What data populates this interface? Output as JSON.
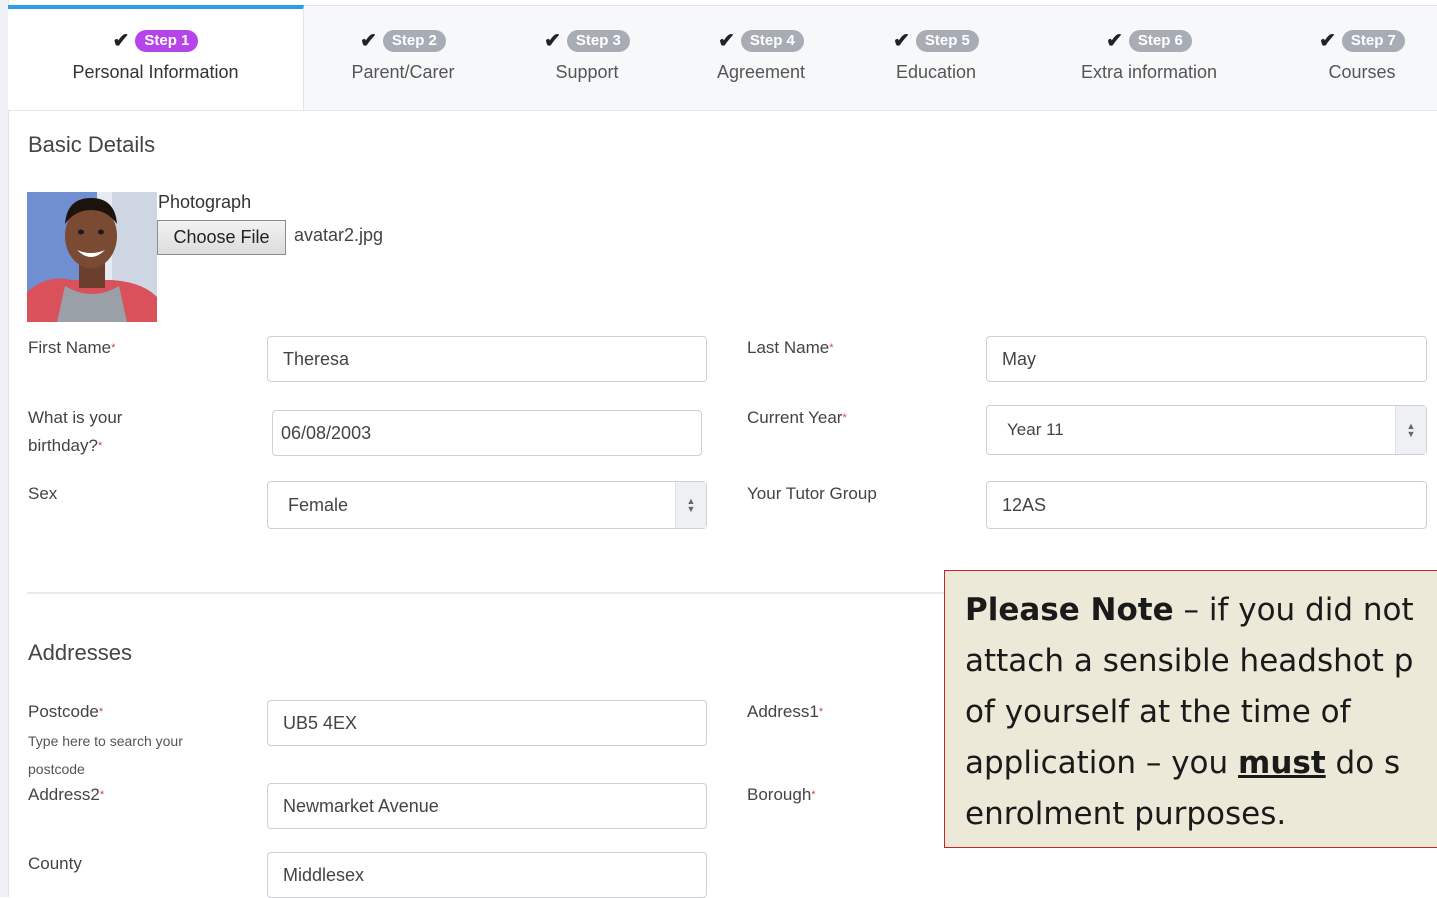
{
  "tabs": [
    {
      "step": "Step 1",
      "label": "Personal Information",
      "active": true
    },
    {
      "step": "Step 2",
      "label": "Parent/Carer"
    },
    {
      "step": "Step 3",
      "label": "Support"
    },
    {
      "step": "Step 4",
      "label": "Agreement"
    },
    {
      "step": "Step 5",
      "label": "Education"
    },
    {
      "step": "Step 6",
      "label": "Extra information"
    },
    {
      "step": "Step 7",
      "label": "Courses"
    }
  ],
  "check_glyph": "✔",
  "basic": {
    "title": "Basic Details",
    "photo_label": "Photograph",
    "choose_file": "Choose File",
    "file_name": "avatar2.jpg",
    "first_name_label": "First Name",
    "first_name": "Theresa",
    "last_name_label": "Last Name",
    "last_name": "May",
    "birthday_label_1": "What is your",
    "birthday_label_2": "birthday?",
    "birthday": "06/08/2003",
    "current_year_label": "Current Year",
    "current_year": "Year 11",
    "sex_label": "Sex",
    "sex": "Female",
    "tutor_label": "Your Tutor Group",
    "tutor": "12AS",
    "required_mark": "*"
  },
  "addresses": {
    "title": "Addresses",
    "postcode_label": "Postcode",
    "postcode_hint_1": "Type here to search your",
    "postcode_hint_2": "postcode",
    "postcode": "UB5 4EX",
    "address1_label": "Address1",
    "address2_label": "Address2",
    "address2": "Newmarket Avenue",
    "borough_label": "Borough",
    "county_label": "County",
    "county": "Middlesex"
  },
  "note": {
    "bold_lead": "Please Note",
    "line1_rest": " – if you did not",
    "line2": "attach a sensible headshot p",
    "line3": "of yourself at the time of",
    "line4_a": "application – you ",
    "line4_must": "must",
    "line4_b": " do s",
    "line5": "enrolment purposes."
  },
  "colors": {
    "active_tab_accent": "#2f9ee8",
    "active_step_badge": "#b545e8",
    "inactive_step_badge": "#a8adb5",
    "required": "#e0413b",
    "note_border": "#c0282d",
    "note_background": "#ece9d8"
  }
}
